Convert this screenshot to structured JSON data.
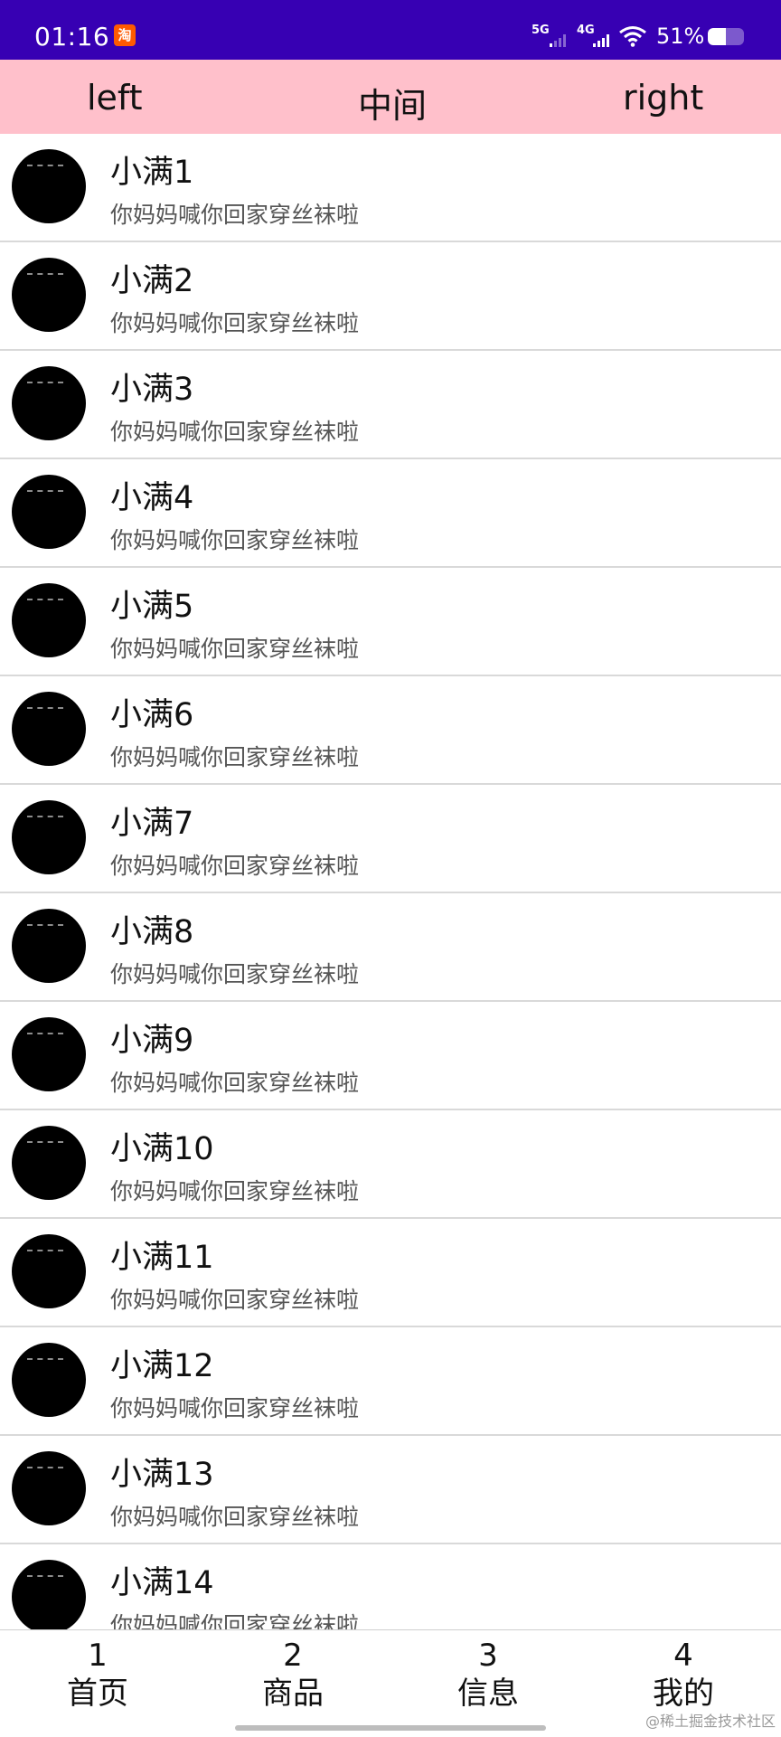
{
  "status_bar": {
    "time": "01:16",
    "app_badge": "淘",
    "network_1": "5G",
    "network_2": "4G",
    "battery_text": "51%",
    "battery_level": 0.51,
    "background": "#3700b3"
  },
  "top_bar": {
    "left": "left",
    "center": "中间",
    "right": "right",
    "background": "#ffc0cb"
  },
  "list": {
    "items": [
      {
        "title": "小满1",
        "subtitle": "你妈妈喊你回家穿丝袜啦"
      },
      {
        "title": "小满2",
        "subtitle": "你妈妈喊你回家穿丝袜啦"
      },
      {
        "title": "小满3",
        "subtitle": "你妈妈喊你回家穿丝袜啦"
      },
      {
        "title": "小满4",
        "subtitle": "你妈妈喊你回家穿丝袜啦"
      },
      {
        "title": "小满5",
        "subtitle": "你妈妈喊你回家穿丝袜啦"
      },
      {
        "title": "小满6",
        "subtitle": "你妈妈喊你回家穿丝袜啦"
      },
      {
        "title": "小满7",
        "subtitle": "你妈妈喊你回家穿丝袜啦"
      },
      {
        "title": "小满8",
        "subtitle": "你妈妈喊你回家穿丝袜啦"
      },
      {
        "title": "小满9",
        "subtitle": "你妈妈喊你回家穿丝袜啦"
      },
      {
        "title": "小满10",
        "subtitle": "你妈妈喊你回家穿丝袜啦"
      },
      {
        "title": "小满11",
        "subtitle": "你妈妈喊你回家穿丝袜啦"
      },
      {
        "title": "小满12",
        "subtitle": "你妈妈喊你回家穿丝袜啦"
      },
      {
        "title": "小满13",
        "subtitle": "你妈妈喊你回家穿丝袜啦"
      },
      {
        "title": "小满14",
        "subtitle": "你妈妈喊你回家穿丝袜啦"
      }
    ]
  },
  "tabbar": {
    "tabs": [
      {
        "num": "1",
        "label": "首页"
      },
      {
        "num": "2",
        "label": "商品"
      },
      {
        "num": "3",
        "label": "信息"
      },
      {
        "num": "4",
        "label": "我的"
      }
    ]
  },
  "watermark": "@稀土掘金技术社区"
}
